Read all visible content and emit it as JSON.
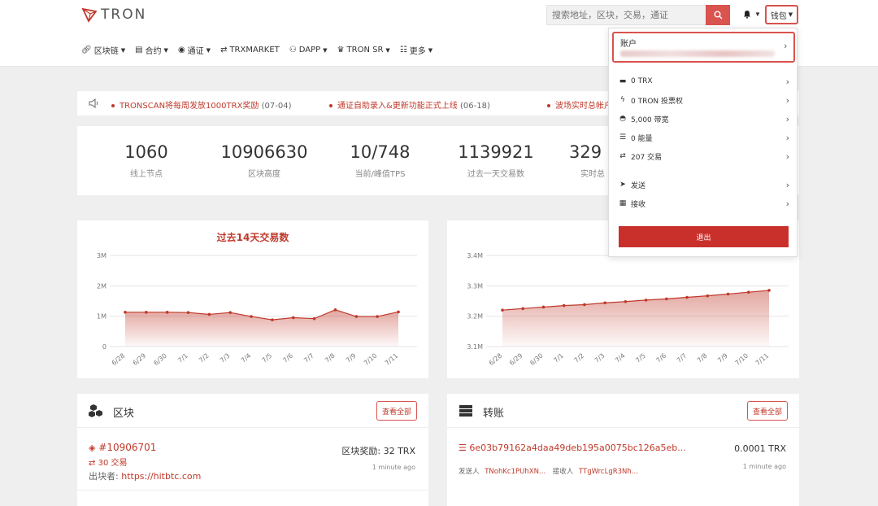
{
  "header": {
    "logo_text": "TRON",
    "search_placeholder": "搜索地址，区块，交易，通证",
    "wallet_label": "钱包"
  },
  "nav": [
    {
      "label": "区块链",
      "icon": "link-icon"
    },
    {
      "label": "合约",
      "icon": "document-icon"
    },
    {
      "label": "通证",
      "icon": "coins-icon"
    },
    {
      "label": "TRXMARKET",
      "icon": "exchange-icon"
    },
    {
      "label": "DAPP",
      "icon": "gamepad-icon"
    },
    {
      "label": "TRON SR",
      "icon": "crown-icon"
    },
    {
      "label": "更多",
      "icon": "list-icon"
    }
  ],
  "notices": [
    {
      "text": "TRONSCAN将每周发放1000TRX奖励",
      "date": "(07-04)"
    },
    {
      "text": "通证自助录入&更新功能正式上线",
      "date": "(06-18)"
    },
    {
      "text": "波场实时总帐户",
      "date": ""
    }
  ],
  "stats": [
    {
      "value": "1060",
      "label": "线上节点"
    },
    {
      "value": "10906630",
      "label": "区块高度"
    },
    {
      "value": "10/748",
      "label": "当前/峰值TPS"
    },
    {
      "value": "1139921",
      "label": "过去一天交易数"
    },
    {
      "value": "329",
      "label": "实时总"
    }
  ],
  "charts": {
    "left": {
      "title": "过去14天交易数",
      "yticks": [
        "3M",
        "2M",
        "1M",
        "0"
      ],
      "xticks": [
        "6/28",
        "6/29",
        "6/30",
        "7/1",
        "7/2",
        "7/3",
        "7/4",
        "7/5",
        "7/6",
        "7/7",
        "7/8",
        "7/9",
        "7/10",
        "7/11"
      ]
    },
    "right": {
      "title": "过去1",
      "yticks": [
        "3.4M",
        "3.3M",
        "3.2M",
        "3.1M"
      ],
      "xticks": [
        "6/28",
        "6/29",
        "6/30",
        "7/1",
        "7/2",
        "7/3",
        "7/4",
        "7/5",
        "7/6",
        "7/7",
        "7/8",
        "7/9",
        "7/10",
        "7/11"
      ]
    }
  },
  "chart_data": [
    {
      "type": "area",
      "title": "过去14天交易数",
      "x": [
        "6/28",
        "6/29",
        "6/30",
        "7/1",
        "7/2",
        "7/3",
        "7/4",
        "7/5",
        "7/6",
        "7/7",
        "7/8",
        "7/9",
        "7/10",
        "7/11"
      ],
      "series": [
        {
          "values": [
            1130000,
            1130000,
            1130000,
            1120000,
            1060000,
            1120000,
            990000,
            880000,
            950000,
            920000,
            1210000,
            990000,
            990000,
            1140000
          ]
        }
      ],
      "ylim": [
        0,
        3000000
      ],
      "grid": true,
      "color": "#c0392b"
    },
    {
      "type": "area",
      "title": "过去1",
      "x": [
        "6/28",
        "6/29",
        "6/30",
        "7/1",
        "7/2",
        "7/3",
        "7/4",
        "7/5",
        "7/6",
        "7/7",
        "7/8",
        "7/9",
        "7/10",
        "7/11"
      ],
      "series": [
        {
          "values": [
            3220000,
            3225000,
            3230000,
            3235000,
            3238000,
            3244000,
            3248000,
            3253000,
            3257000,
            3262000,
            3267000,
            3273000,
            3279000,
            3285000
          ]
        }
      ],
      "ylim": [
        3100000,
        3400000
      ],
      "grid": true,
      "color": "#c0392b"
    }
  ],
  "blocks": {
    "title": "区块",
    "view_all": "查看全部",
    "item": {
      "number": "#10906701",
      "tx": "30 交易",
      "producer_label": "出块者:",
      "producer": "https://hitbtc.com",
      "reward": "区块奖励: 32 TRX",
      "time": "1 minute ago"
    }
  },
  "transfers": {
    "title": "转账",
    "view_all": "查看全部",
    "item": {
      "hash": "6e03b79162a4daa49deb195a0075bc126a5eb...",
      "amount": "0.0001 TRX",
      "from_label": "发送人",
      "from": "TNohKc1PUhXN...",
      "to_label": "接收人",
      "to": "TTgWrcLgR3Nh...",
      "time": "1 minute ago"
    }
  },
  "dropdown": {
    "account_title": "账户",
    "rows": [
      {
        "icon": "wallet-icon",
        "glyph": "▬",
        "label": "0 TRX"
      },
      {
        "icon": "bolt-icon",
        "glyph": "ϟ",
        "label": "0 TRON 投票权"
      },
      {
        "icon": "gauge-icon",
        "glyph": "◓",
        "label": "5,000 带宽"
      },
      {
        "icon": "energy-icon",
        "glyph": "☰",
        "label": "0 能量"
      },
      {
        "icon": "exchange-icon",
        "glyph": "⇄",
        "label": "207 交易"
      },
      {
        "icon": "send-icon",
        "glyph": "➤",
        "label": "发送"
      },
      {
        "icon": "qrcode-icon",
        "glyph": "▦",
        "label": "接收"
      }
    ],
    "logout": "退出"
  }
}
